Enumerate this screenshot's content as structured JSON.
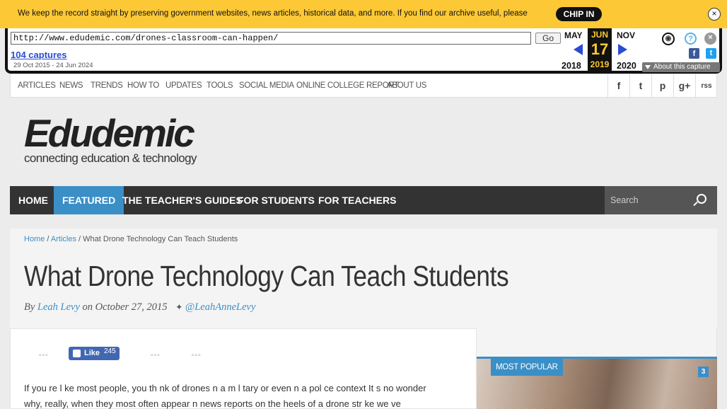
{
  "banner": {
    "text": "We keep the record straight by preserving government websites, news articles, historical data, and more. If you find our archive useful, please",
    "chip_in_label": "CHIP IN",
    "close_label": "×"
  },
  "wayback": {
    "url": "http://www.edudemic.com/drones-classroom-can-happen/",
    "go_label": "Go",
    "captures_label": "104 captures",
    "capture_range": "29 Oct 2015 - 24 Jun 2024",
    "prev_month": "MAY",
    "cur_month": "JUN",
    "next_month": "NOV",
    "cur_day": "17",
    "prev_year": "2018",
    "cur_year": "2019",
    "next_year": "2020",
    "about_label": "About this capture",
    "help_icon": "?",
    "close_icon": "×",
    "facebook_icon": "f",
    "twitter_icon": "t"
  },
  "topnav": {
    "items": [
      "ARTICLES",
      "NEWS",
      "TRENDS",
      "HOW TO",
      "UPDATES",
      "TOOLS",
      "SOCIAL MEDIA",
      "ONLINE COLLEGE REPORT",
      "ABOUT US"
    ],
    "social": [
      "f",
      "t",
      "p",
      "g+",
      "rss"
    ]
  },
  "header": {
    "logo": "Edudemic",
    "tagline": "connecting education & technology"
  },
  "menu": {
    "items": [
      "HOME",
      "FEATURED",
      "THE TEACHER'S GUIDES",
      "FOR STUDENTS",
      "FOR TEACHERS"
    ],
    "search_placeholder": "Search"
  },
  "article": {
    "breadcrumb_home": "Home",
    "breadcrumb_sep": "/",
    "breadcrumb_section": "Articles",
    "breadcrumb_current": "What Drone Technology Can Teach Students",
    "title": "What Drone Technology Can Teach Students",
    "by": "By",
    "author": "Leah Levy",
    "date": "on October 27, 2015",
    "twitter_handle": "@LeahAnneLevy",
    "like_label": "Like",
    "like_count": "245",
    "body_line1": "If you re l ke most people, you th nk of drones  n a m l tary or even  n a pol ce context  It s no wonder",
    "body_line2": "why, really, when they most often appear  n news reports on the heels of a drone str ke we ve"
  },
  "sidebar": {
    "popular_label": "MOST POPULAR",
    "popular_number": "3"
  },
  "colors": {
    "banner": "#fcc835",
    "accent": "#3a8fc7",
    "menu_bg": "#333333"
  }
}
